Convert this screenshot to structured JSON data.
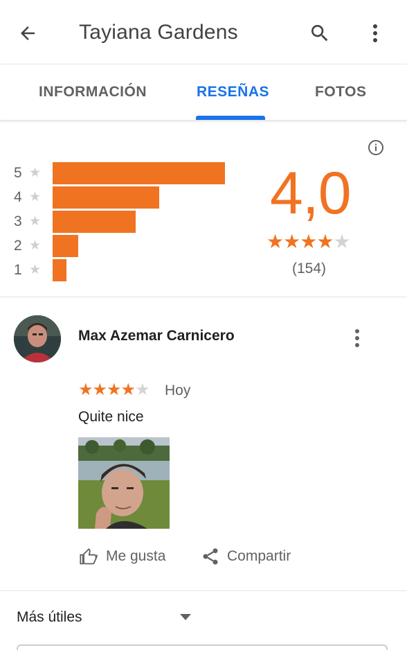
{
  "appbar": {
    "title": "Tayiana Gardens",
    "back_icon": "arrow-back-icon",
    "search_icon": "search-icon",
    "more_icon": "more-vert-icon"
  },
  "tabs": [
    {
      "label": "INFORMACIÓN",
      "active": false
    },
    {
      "label": "RESEÑAS",
      "active": true
    },
    {
      "label": "FOTOS",
      "active": false
    }
  ],
  "summary": {
    "rating": "4,0",
    "count": "(154)",
    "stars_filled": 4,
    "stars_total": 5,
    "histogram": [
      {
        "label": "5",
        "fraction": 1.0
      },
      {
        "label": "4",
        "fraction": 0.62
      },
      {
        "label": "3",
        "fraction": 0.48
      },
      {
        "label": "2",
        "fraction": 0.15
      },
      {
        "label": "1",
        "fraction": 0.08
      }
    ]
  },
  "review": {
    "author": "Max Azemar Carnicero",
    "stars_filled": 4,
    "stars_total": 5,
    "date": "Hoy",
    "text": "Quite nice",
    "actions": {
      "like": "Me gusta",
      "share": "Compartir"
    }
  },
  "sort": {
    "label": "Más útiles"
  },
  "colors": {
    "accent": "#f07322",
    "tab_active": "#1a73e8",
    "text_secondary": "#616161"
  }
}
